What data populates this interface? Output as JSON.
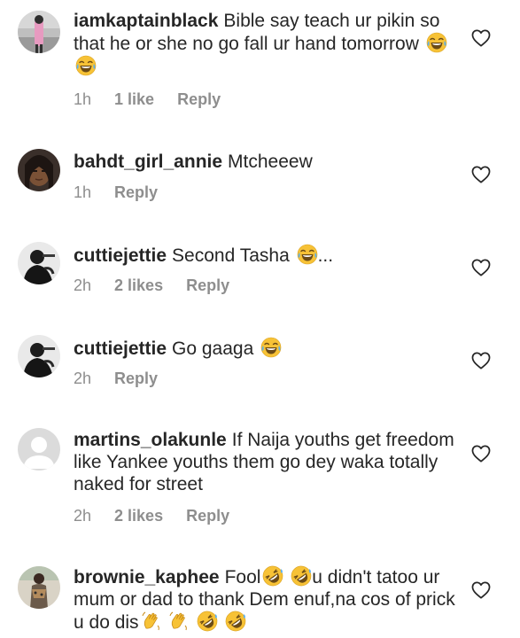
{
  "comments": [
    {
      "username": "iamkaptainblack",
      "text": "Bible say teach ur pikin so that he or she no go fall ur hand tomorrow",
      "emojis": [
        "tears-of-joy",
        "tears-of-joy"
      ],
      "time": "1h",
      "likes": "1 like",
      "reply": "Reply"
    },
    {
      "username": "bahdt_girl_annie",
      "text": "Mtcheeew",
      "time": "1h",
      "reply": "Reply"
    },
    {
      "username": "cuttiejettie",
      "text": "Second Tasha",
      "emojis": [
        "tears-of-joy"
      ],
      "suffix": "...",
      "time": "2h",
      "likes": "2 likes",
      "reply": "Reply"
    },
    {
      "username": "cuttiejettie",
      "text": "Go gaaga",
      "emojis": [
        "tears-of-joy"
      ],
      "time": "2h",
      "reply": "Reply"
    },
    {
      "username": "martins_olakunle",
      "text": "If Naija youths get freedom like Yankee youths them go dey waka totally naked for street",
      "time": "2h",
      "likes": "2 likes",
      "reply": "Reply"
    },
    {
      "username": "brownie_kaphee",
      "text_1": "Fool",
      "text_2": "u didn't tatoo ur mum or dad to thank Dem enuf,na cos of prick u do dis"
    }
  ],
  "icons": {
    "like": "heart-outline-icon",
    "laugh": "tears-of-joy-emoji",
    "rofl": "rolling-on-floor-laughing-emoji",
    "wave": "waving-hand-emoji"
  },
  "colors": {
    "text": "#262626",
    "meta": "#8e8e8e",
    "emoji_face": "#f7c236",
    "emoji_tear": "#5ab0f0"
  }
}
